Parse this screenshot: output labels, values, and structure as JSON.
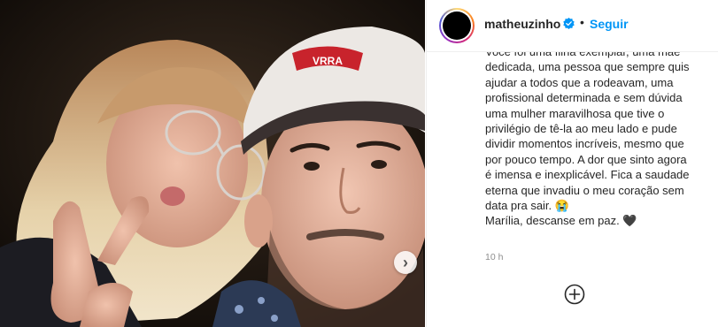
{
  "post": {
    "username": "matheuzinho",
    "separator": "•",
    "follow_label": "Seguir",
    "caption_lines": [
      "Você foi uma filha exemplar, uma mãe",
      "dedicada, uma pessoa que sempre quis",
      "ajudar a todos que a rodeavam, uma",
      "profissional determinada e sem dúvida",
      "uma mulher maravilhosa que tive o",
      "privilégio de tê-la ao meu lado e pude",
      "dividir momentos incríveis, mesmo que",
      "por pouco tempo. A dor que sinto agora",
      "é imensa e inexplicável. Fica a saudade",
      "eterna que invadiu o meu coração sem",
      "data pra sair. 😭",
      "Marília, descanse em paz. 🖤"
    ],
    "timestamp": "10 h",
    "cap_text": "VRRA"
  },
  "icons": {
    "verified": "verified-badge-icon",
    "next": "chevron-right-icon",
    "load_more": "plus-circle-icon"
  },
  "colors": {
    "accent": "#0095f6",
    "muted": "#8e8e8e",
    "text": "#262626"
  }
}
